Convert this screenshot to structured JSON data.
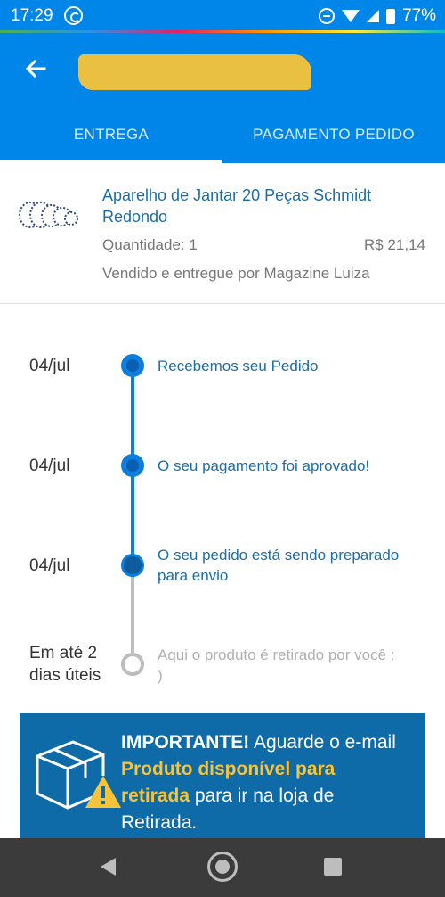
{
  "status_bar": {
    "time": "17:29",
    "battery": "77%"
  },
  "app_bar": {
    "tabs": [
      {
        "label": "ENTREGA",
        "active": true
      },
      {
        "label": "PAGAMENTO PEDIDO",
        "active": false
      }
    ]
  },
  "product": {
    "name": "Aparelho de Jantar 20 Peças Schmidt Redondo",
    "quantity": "Quantidade: 1",
    "price": "R$ 21,14",
    "seller": "Vendido e entregue por Magazine Luiza"
  },
  "timeline": [
    {
      "date": "04/jul",
      "text": "Recebemos seu Pedido",
      "state": "done"
    },
    {
      "date": "04/jul",
      "text": "O seu pagamento foi aprovado!",
      "state": "done"
    },
    {
      "date": "04/jul",
      "text": "O seu pedido está sendo preparado para envio",
      "state": "current"
    },
    {
      "date": "Em até 2 dias úteis",
      "text": "Aqui o produto é retirado por você : )",
      "state": "pending"
    }
  ],
  "important": {
    "strong": "IMPORTANTE!",
    "part1": " Aguarde o e-mail ",
    "highlight": "Produto disponível para retirada",
    "part2": " para ir na loja de Retirada."
  },
  "colors": {
    "primary": "#0086e8",
    "timeline_active": "#0a7fe0",
    "timeline_pending": "#bdbdbd",
    "important_bg": "#0e6ba8",
    "highlight": "#f7c33a"
  }
}
